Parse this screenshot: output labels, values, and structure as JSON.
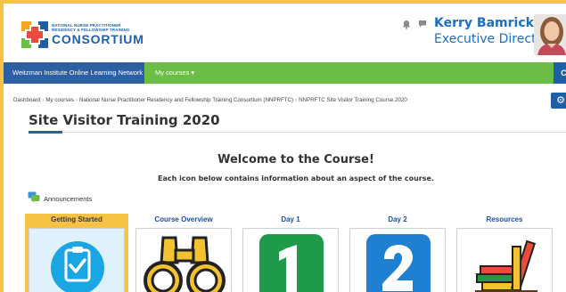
{
  "header": {
    "logo_line1": "NATIONAL NURSE PRACTITIONER",
    "logo_line2": "RESIDENCY & FELLOWSHIP TRAINING",
    "logo_name": "CONSORTIUM",
    "user_name": "Kerry Bamrick",
    "user_role": "Executive Director",
    "icons": [
      "bell-icon",
      "chat-icon"
    ]
  },
  "nav": {
    "home": "Weitzman Institute Online Learning Network",
    "my_courses": "My courses ▾",
    "right_label": "C"
  },
  "breadcrumb": [
    "Dashboard",
    "My courses",
    "National Nurse Practitioner Residency and Fellowship Training Consortium (NNPRFTC)",
    "NNPRFTC Site Visitor Training Course 2020"
  ],
  "page_title": "Site Visitor Training 2020",
  "content": {
    "welcome": "Welcome to the Course!",
    "subtitle": "Each icon below contains information about an aspect of the course.",
    "announcements": "Announcements"
  },
  "tiles": [
    {
      "label": "Getting Started",
      "icon": "clipboard-check-icon",
      "active": true
    },
    {
      "label": "Course Overview",
      "icon": "binoculars-icon",
      "active": false
    },
    {
      "label": "Day 1",
      "icon": "number-1-icon",
      "active": false
    },
    {
      "label": "Day 2",
      "icon": "number-2-icon",
      "active": false
    },
    {
      "label": "Resources",
      "icon": "books-icon",
      "active": false
    }
  ],
  "colors": {
    "frame": "#f6c344",
    "nav_green": "#6bbd45",
    "nav_blue": "#2c5fa3",
    "link_blue": "#1a6fc4",
    "day1_green": "#1e9a4a",
    "day2_blue": "#1f7fd0"
  }
}
